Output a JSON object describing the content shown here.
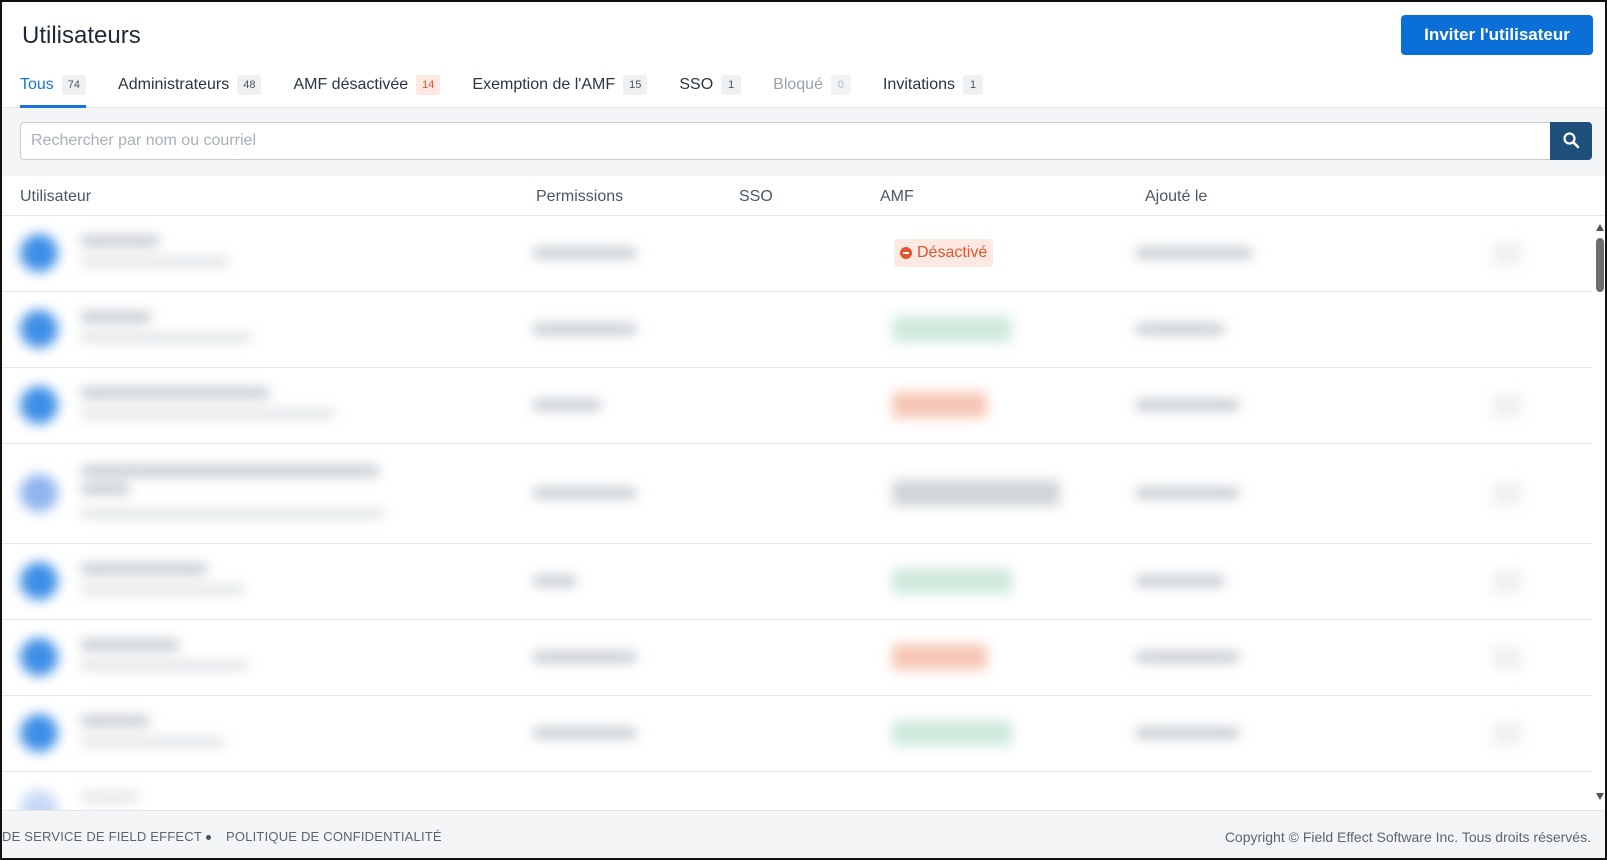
{
  "header": {
    "title": "Utilisateurs",
    "invite_label": "Inviter l'utilisateur"
  },
  "tabs": [
    {
      "label": "Tous",
      "count": "74"
    },
    {
      "label": "Administrateurs",
      "count": "48"
    },
    {
      "label": "AMF désactivée",
      "count": "14"
    },
    {
      "label": "Exemption de l'AMF",
      "count": "15"
    },
    {
      "label": "SSO",
      "count": "1"
    },
    {
      "label": "Bloqué",
      "count": "0"
    },
    {
      "label": "Invitations",
      "count": "1"
    }
  ],
  "search": {
    "placeholder": "Rechercher par nom ou courriel",
    "value": ""
  },
  "table": {
    "columns": [
      "Utilisateur",
      "Permissions",
      "SSO",
      "AMF",
      "Ajouté le"
    ],
    "rows": [
      {
        "mfa": "Désactivé"
      }
    ]
  },
  "footer": {
    "terms_link": "DE SERVICE DE FIELD EFFECT",
    "privacy_link": "POLITIQUE DE CONFIDENTIALITÉ",
    "copyright": "Copyright © Field Effect Software Inc. Tous droits réservés."
  },
  "colors": {
    "accent": "#0b6fd8",
    "tab_active": "#1a73d9",
    "search_button": "#1d4f7a",
    "mfa_disabled": "#e0552e"
  }
}
